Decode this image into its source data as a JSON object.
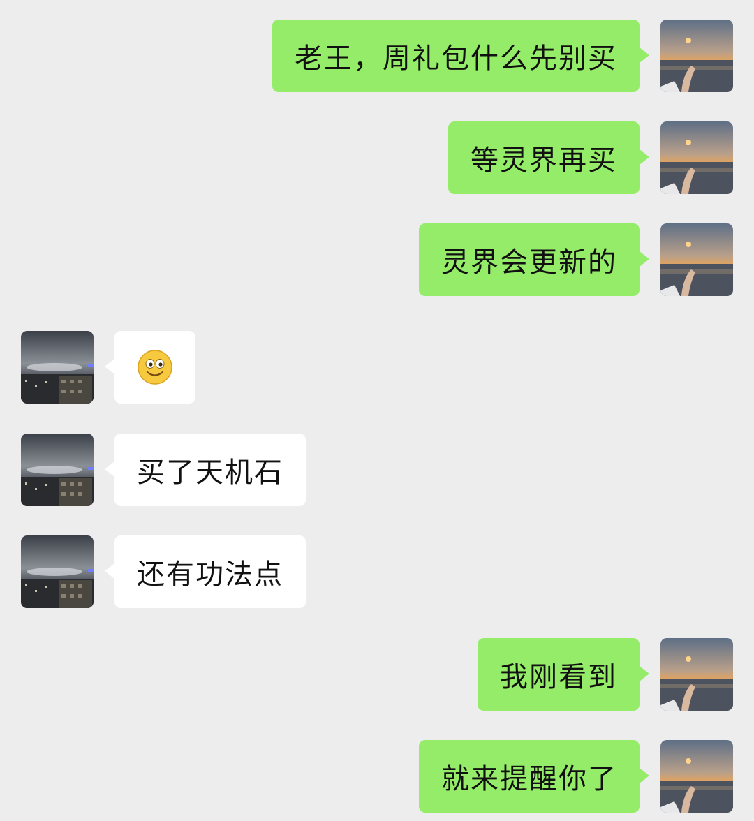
{
  "messages": [
    {
      "side": "out",
      "text": "老王，周礼包什么先别买"
    },
    {
      "side": "out",
      "text": "等灵界再买"
    },
    {
      "side": "out",
      "text": "灵界会更新的"
    },
    {
      "side": "in",
      "emoji": "smile-emoji"
    },
    {
      "side": "in",
      "text": "买了天机石"
    },
    {
      "side": "in",
      "text": "还有功法点"
    },
    {
      "side": "out",
      "text": "我刚看到"
    },
    {
      "side": "out",
      "text": "就来提醒你了"
    }
  ],
  "colors": {
    "background": "#ededed",
    "outgoing_bubble": "#95ec69",
    "incoming_bubble": "#ffffff",
    "text": "#111111"
  }
}
